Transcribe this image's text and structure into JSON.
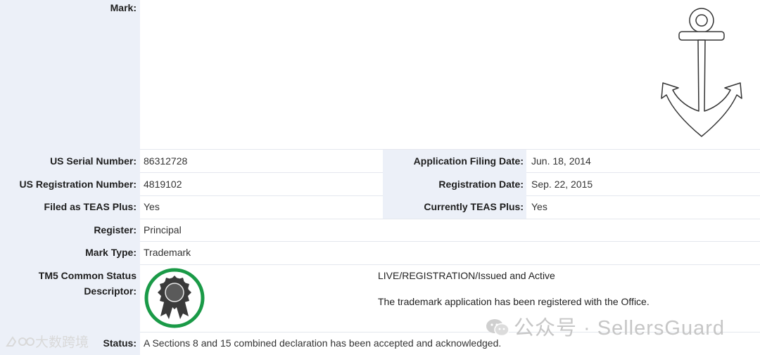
{
  "mark": {
    "label": "Mark:",
    "image": "anchor-drawing"
  },
  "rows": {
    "serial": {
      "label": "US Serial Number:",
      "value": "86312728"
    },
    "filing_date": {
      "label": "Application Filing Date:",
      "value": "Jun. 18, 2014"
    },
    "registration_number": {
      "label": "US Registration Number:",
      "value": "4819102"
    },
    "registration_date": {
      "label": "Registration Date:",
      "value": "Sep. 22, 2015"
    },
    "filed_teas_plus": {
      "label": "Filed as TEAS Plus:",
      "value": "Yes"
    },
    "currently_teas_plus": {
      "label": "Currently TEAS Plus:",
      "value": "Yes"
    },
    "register": {
      "label": "Register:",
      "value": "Principal"
    },
    "mark_type": {
      "label": "Mark Type:",
      "value": "Trademark"
    },
    "tm5": {
      "label_line1": "TM5 Common Status",
      "label_line2": "Descriptor:",
      "icon": "registered-seal-icon",
      "status_title": "LIVE/REGISTRATION/Issued and Active",
      "status_desc": "The trademark application has been registered with the Office."
    },
    "status": {
      "label": "Status:",
      "value": "A Sections 8 and 15 combined declaration has been accepted and acknowledged."
    }
  },
  "watermarks": {
    "right": "公众号 · SellersGuard",
    "left": "大数跨境"
  },
  "colors": {
    "label_bg": "#ecf0f8",
    "seal_ring": "#1a9a47",
    "seal_body": "#3a3a3a"
  }
}
